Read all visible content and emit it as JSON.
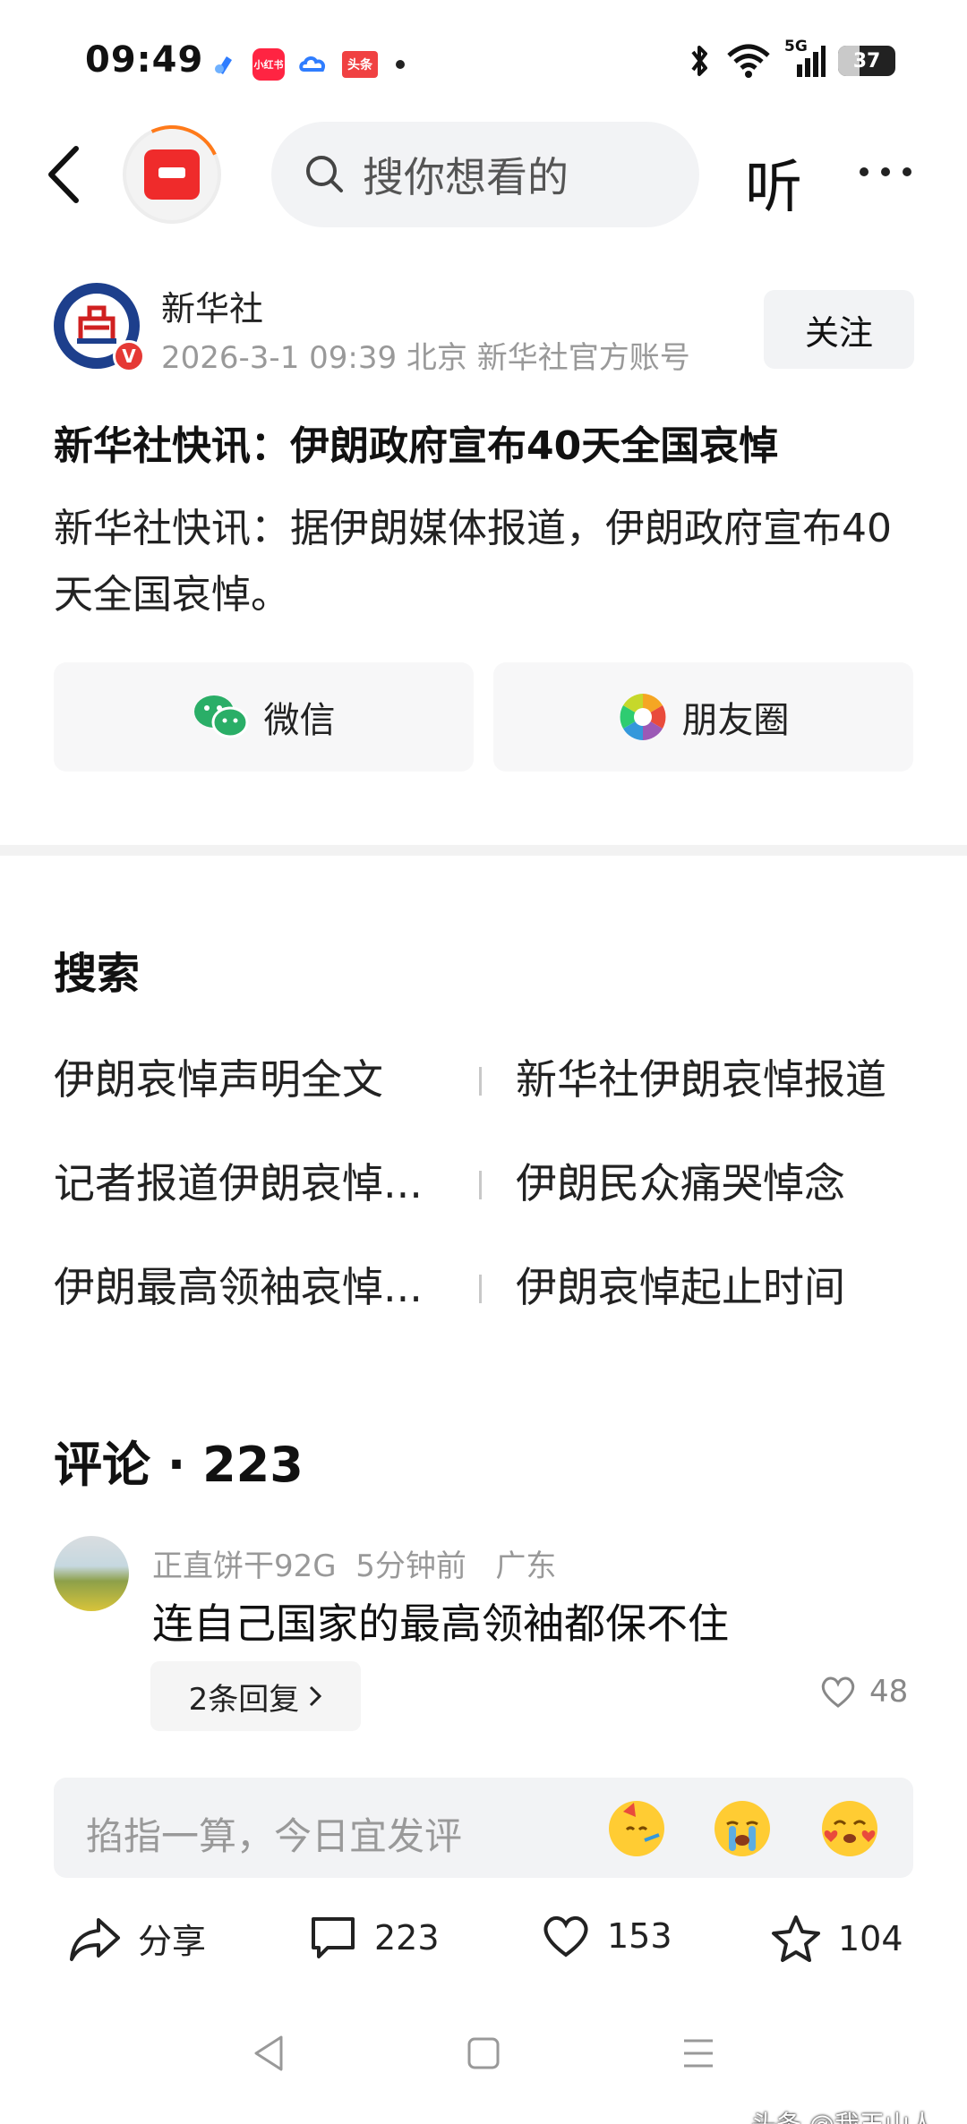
{
  "status_bar": {
    "time": "09:49",
    "apps": [
      {
        "icon": "browser-app-icon",
        "label": "",
        "color": "#2f7dff"
      },
      {
        "icon": "xiaohongshu-app-icon",
        "label": "小红书",
        "color": "#ff2442"
      },
      {
        "icon": "cloud-app-icon",
        "label": "",
        "color": "#2f7dff"
      },
      {
        "icon": "toutiao-app-icon",
        "label": "头条",
        "color": "#f04142"
      }
    ],
    "network": "5G",
    "battery": "37",
    "battery_level": 0.37
  },
  "top_nav": {
    "search_placeholder": "搜你想看的",
    "listen_label": "听"
  },
  "author": {
    "name": "新华社",
    "meta": "2026-3-1  09:39  北京  新华社官方账号",
    "verified_badge": "V",
    "follow_label": "关注"
  },
  "article": {
    "title": "新华社快讯：伊朗政府宣布40天全国哀悼",
    "body": "新华社快讯：据伊朗媒体报道，伊朗政府宣布40天全国哀悼。"
  },
  "share": {
    "wechat_label": "微信",
    "moments_label": "朋友圈",
    "wechat_color": "#2aae67"
  },
  "search_section": {
    "title": "搜索",
    "rows": [
      {
        "left": "伊朗哀悼声明全文",
        "right": "新华社伊朗哀悼报道"
      },
      {
        "left": "记者报道伊朗哀悼...",
        "right": "伊朗民众痛哭悼念"
      },
      {
        "left": "伊朗最高领袖哀悼...",
        "right": "伊朗哀悼起止时间"
      }
    ]
  },
  "comments": {
    "title": "评论 · 223",
    "items": [
      {
        "user": "正直饼干92G",
        "time": "5分钟前",
        "location": "广东",
        "text": "连自己国家的最高领袖都保不住",
        "replies_label": "2条回复",
        "likes": "48"
      }
    ],
    "input_placeholder": "掐指一算，今日宜发评"
  },
  "actions": {
    "share": "分享",
    "comments": "223",
    "likes": "153",
    "favorites": "104"
  },
  "watermark": "头条 @我玉山人"
}
